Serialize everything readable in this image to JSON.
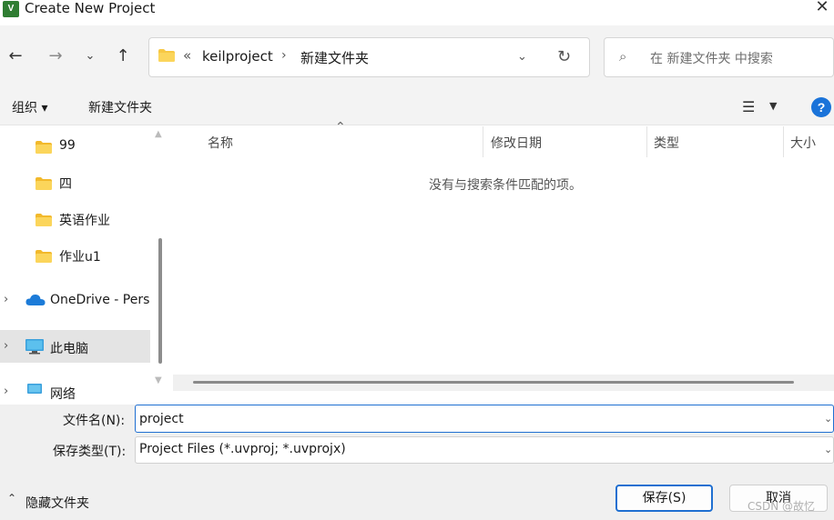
{
  "window": {
    "title": "Create New Project",
    "app_icon": "uv-icon",
    "close_label": "✕"
  },
  "nav": {
    "address_root": "«",
    "address_segments": [
      "keilproject",
      "新建文件夹"
    ],
    "address_separator": "›",
    "search_placeholder": "在 新建文件夹 中搜索"
  },
  "toolbar": {
    "organize_label": "组织 ▾",
    "new_folder_label": "新建文件夹"
  },
  "sidebar": {
    "items": [
      {
        "label": "99",
        "icon": "folder-icon"
      },
      {
        "label": "四",
        "icon": "folder-icon"
      },
      {
        "label": "英语作业",
        "icon": "folder-icon"
      },
      {
        "label": "作业u1",
        "icon": "folder-icon"
      },
      {
        "label": "OneDrive - Pers",
        "icon": "cloud-icon"
      },
      {
        "label": "此电脑",
        "icon": "computer-icon"
      },
      {
        "label": "网络",
        "icon": "network-icon"
      }
    ]
  },
  "filelist": {
    "columns": [
      "名称",
      "修改日期",
      "类型",
      "大小"
    ],
    "empty_message": "没有与搜索条件匹配的项。"
  },
  "form": {
    "filename_label": "文件名(N):",
    "filename_value": "project",
    "filetype_label": "保存类型(T):",
    "filetype_value": "Project Files (*.uvproj; *.uvprojx)"
  },
  "footer": {
    "hide_folders_label": "隐藏文件夹",
    "save_label": "保存(S)",
    "cancel_label": "取消",
    "watermark": "CSDN @故忆"
  },
  "colors": {
    "accent": "#1f6fd1",
    "folder": "#f7c843",
    "help": "#1a73d9"
  }
}
